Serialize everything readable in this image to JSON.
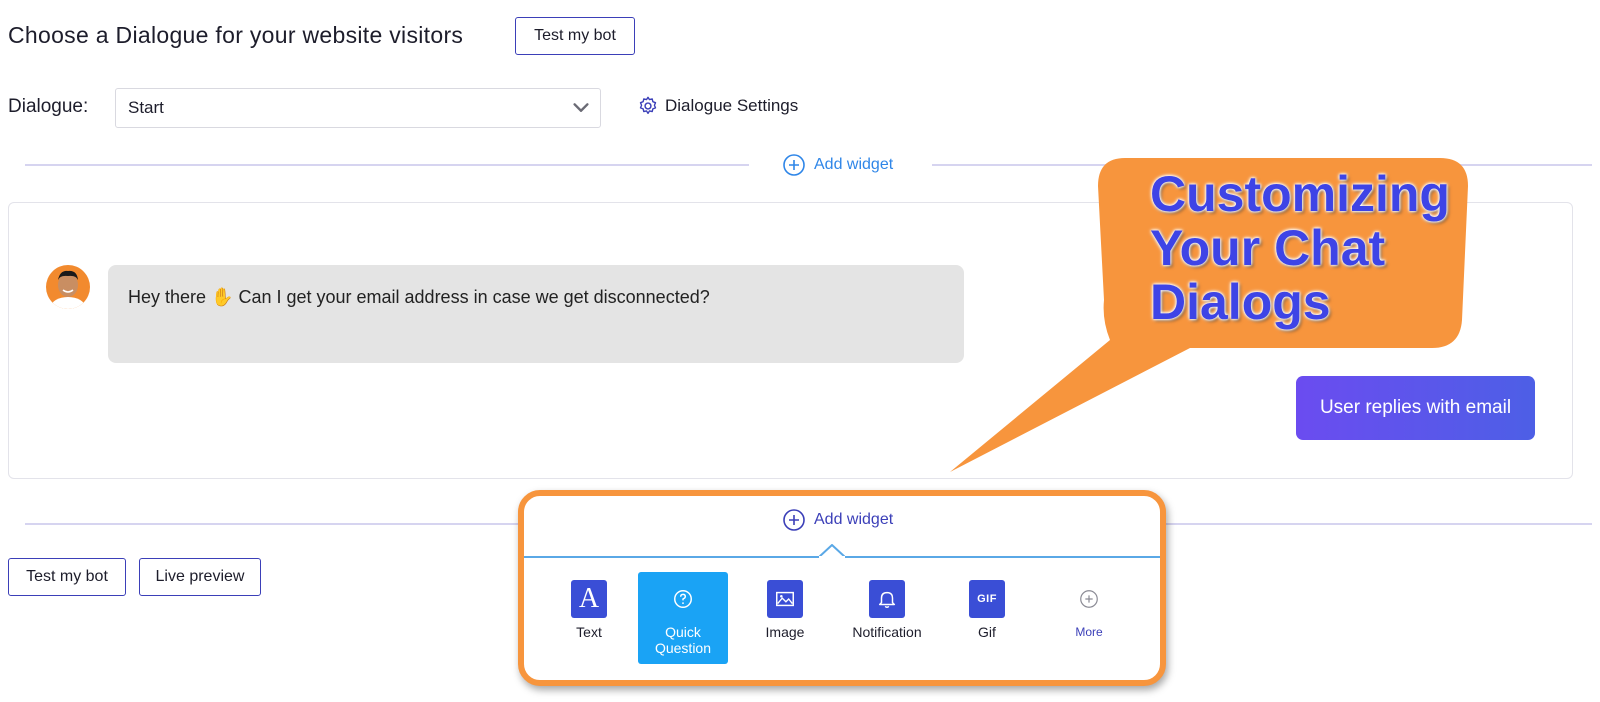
{
  "header": {
    "title": "Choose a Dialogue for your website visitors",
    "test_bot_label": "Test my bot"
  },
  "dialogue": {
    "label": "Dialogue:",
    "selected": "Start",
    "settings_label": "Dialogue Settings"
  },
  "add_widget_label": "Add widget",
  "chat": {
    "bot_message": "Hey there ✋ Can I get your email address in case we get disconnected?",
    "user_reply": "User replies with email"
  },
  "callout": {
    "lines": [
      "Customizing",
      "Your Chat",
      "Dialogs"
    ],
    "color": "#f7953d",
    "text_color": "#3e44e6"
  },
  "footer": {
    "test_bot_label": "Test my bot",
    "live_preview_label": "Live preview"
  },
  "widgets": [
    {
      "label": "Text",
      "icon": "text-a-icon"
    },
    {
      "label": "Quick Question",
      "icon": "question-circle-icon",
      "active": true
    },
    {
      "label": "Image",
      "icon": "image-icon"
    },
    {
      "label": "Notification",
      "icon": "bell-icon"
    },
    {
      "label": "Gif",
      "icon": "gif-icon"
    },
    {
      "label": "More",
      "icon": "plus-circle-icon"
    }
  ],
  "colors": {
    "accent": "#3b3fb8",
    "link_blue": "#2f86e8",
    "active_widget": "#1aa3f5",
    "user_reply_gradient": [
      "#6b4cf0",
      "#4d5fe6"
    ]
  }
}
